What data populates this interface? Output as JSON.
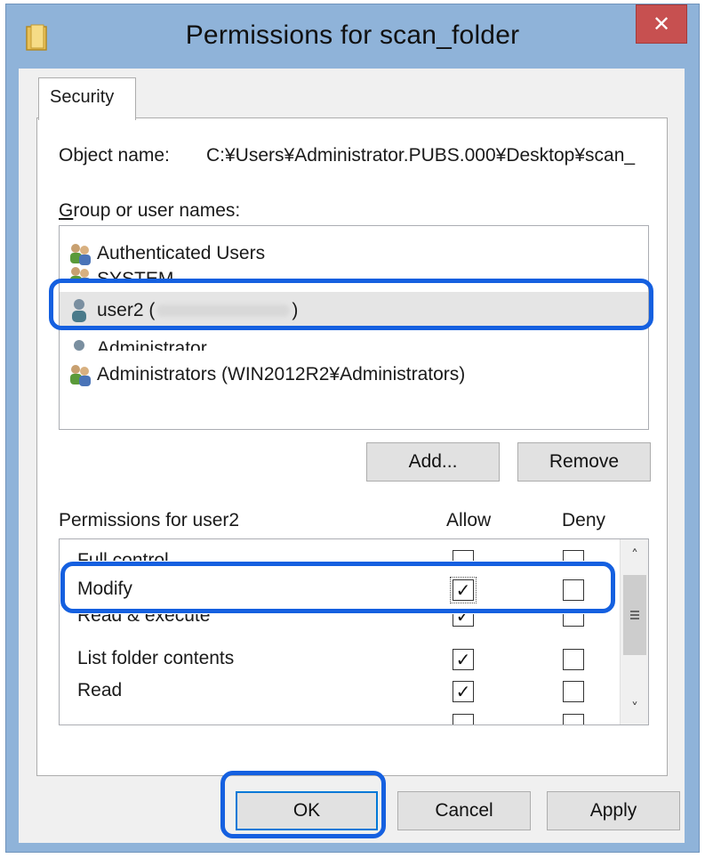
{
  "window": {
    "title": "Permissions for scan_folder",
    "icon": "folder-icon",
    "close_glyph": "✕"
  },
  "tabs": [
    {
      "label": "Security",
      "active": true
    }
  ],
  "object": {
    "label": "Object name:",
    "value": "C:¥Users¥Administrator.PUBS.000¥Desktop¥scan_"
  },
  "groups": {
    "label": "Group or user names:",
    "items": [
      {
        "name": "Authenticated Users",
        "icon": "users-group-icon"
      },
      {
        "name": "SYSTEM",
        "icon": "users-group-icon"
      },
      {
        "name": "user2 (",
        "suffix": ")",
        "icon": "user-icon",
        "selected": true
      },
      {
        "name": "Administrator",
        "icon": "user-icon"
      },
      {
        "name": "Administrators (WIN2012R2¥Administrators)",
        "icon": "users-group-icon"
      }
    ]
  },
  "buttons": {
    "add": "Add...",
    "remove": "Remove",
    "ok": "OK",
    "cancel": "Cancel",
    "apply": "Apply"
  },
  "permissions": {
    "label": "Permissions for user2",
    "allow_header": "Allow",
    "deny_header": "Deny",
    "rows": [
      {
        "name": "Full control",
        "allow": false,
        "deny": false
      },
      {
        "name": "Modify",
        "allow": true,
        "deny": false
      },
      {
        "name": "Read & execute",
        "allow": true,
        "deny": false
      },
      {
        "name": "List folder contents",
        "allow": true,
        "deny": false
      },
      {
        "name": "Read",
        "allow": true,
        "deny": false
      }
    ]
  },
  "checkmark_glyph": "✓",
  "colors": {
    "highlight": "#1560e0",
    "frame": "#8fb3d9",
    "close": "#c75050"
  }
}
